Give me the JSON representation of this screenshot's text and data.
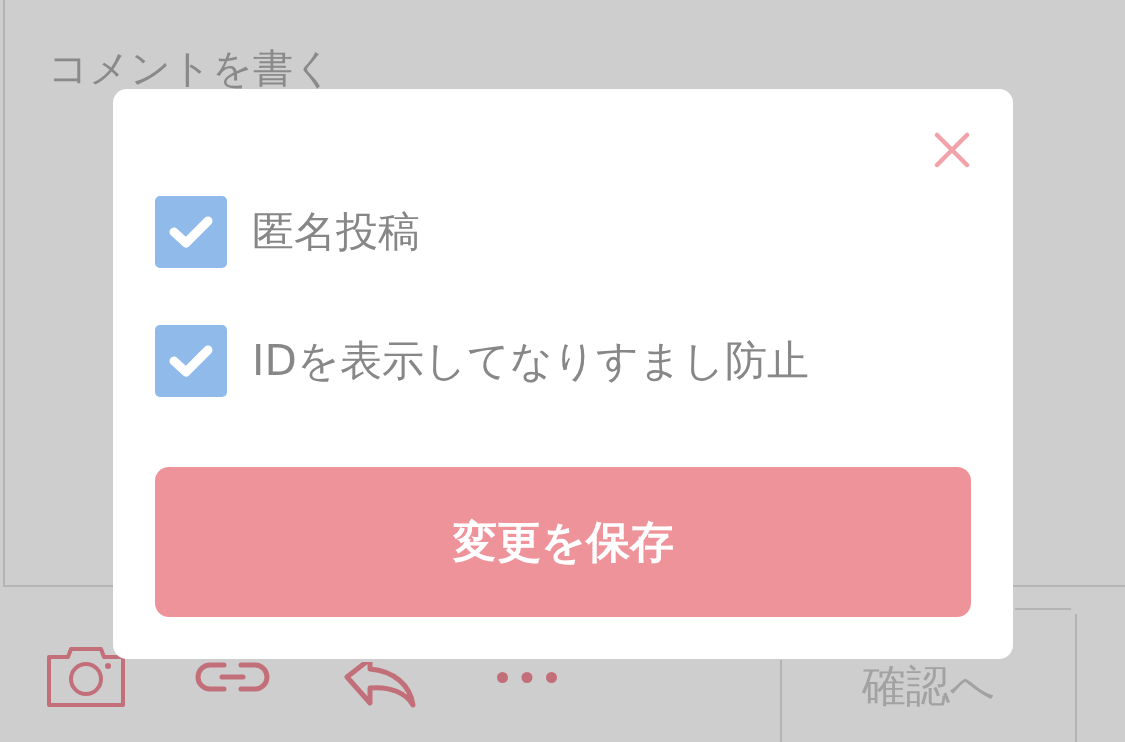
{
  "comment_field": {
    "placeholder": "コメントを書く"
  },
  "toolbar": {
    "confirm_button": {
      "label": "確認へ"
    }
  },
  "dialog": {
    "options": [
      {
        "label": "匿名投稿",
        "checked": true
      },
      {
        "label": "IDを表示してなりすまし防止",
        "checked": true
      }
    ],
    "save_button": {
      "label": "変更を保存"
    }
  }
}
